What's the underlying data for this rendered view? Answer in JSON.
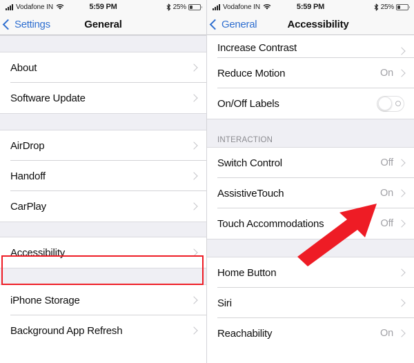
{
  "status_bar": {
    "signal_icon": "signal-bars-icon",
    "carrier": "Vodafone IN",
    "wifi_icon": "wifi-icon",
    "time": "5:59 PM",
    "bluetooth_icon": "bluetooth-icon",
    "battery_percent": "25%",
    "battery_icon": "battery-icon",
    "battery_level": 25
  },
  "left_screen": {
    "nav": {
      "back_label": "Settings",
      "back_icon": "chevron-left-icon",
      "title": "General"
    },
    "groups": [
      {
        "rows": [
          {
            "label": "About",
            "value": "",
            "accessory": "chevron"
          },
          {
            "label": "Software Update",
            "value": "",
            "accessory": "chevron"
          }
        ]
      },
      {
        "rows": [
          {
            "label": "AirDrop",
            "value": "",
            "accessory": "chevron"
          },
          {
            "label": "Handoff",
            "value": "",
            "accessory": "chevron"
          },
          {
            "label": "CarPlay",
            "value": "",
            "accessory": "chevron"
          }
        ]
      },
      {
        "rows": [
          {
            "label": "Accessibility",
            "value": "",
            "accessory": "chevron",
            "highlighted": true
          }
        ]
      },
      {
        "rows": [
          {
            "label": "iPhone Storage",
            "value": "",
            "accessory": "chevron"
          },
          {
            "label": "Background App Refresh",
            "value": "",
            "accessory": "chevron"
          }
        ]
      }
    ]
  },
  "right_screen": {
    "nav": {
      "back_label": "General",
      "back_icon": "chevron-left-icon",
      "title": "Accessibility"
    },
    "groups": [
      {
        "rows": [
          {
            "label": "Increase Contrast",
            "value": "",
            "accessory": "chevron"
          },
          {
            "label": "Reduce Motion",
            "value": "On",
            "accessory": "chevron"
          },
          {
            "label": "On/Off Labels",
            "value": "",
            "accessory": "toggle",
            "toggle_on": false
          }
        ]
      },
      {
        "header": "INTERACTION",
        "rows": [
          {
            "label": "Switch Control",
            "value": "Off",
            "accessory": "chevron"
          },
          {
            "label": "AssistiveTouch",
            "value": "On",
            "accessory": "chevron"
          },
          {
            "label": "Touch Accommodations",
            "value": "Off",
            "accessory": "chevron"
          }
        ]
      },
      {
        "rows": [
          {
            "label": "Home Button",
            "value": "",
            "accessory": "chevron"
          },
          {
            "label": "Siri",
            "value": "",
            "accessory": "chevron"
          },
          {
            "label": "Reachability",
            "value": "On",
            "accessory": "chevron"
          }
        ]
      }
    ]
  },
  "annotations": {
    "highlight_color": "#ee1c25",
    "arrow_color": "#ee1c25",
    "highlight_target": "Accessibility",
    "arrow_target": "AssistiveTouch"
  }
}
